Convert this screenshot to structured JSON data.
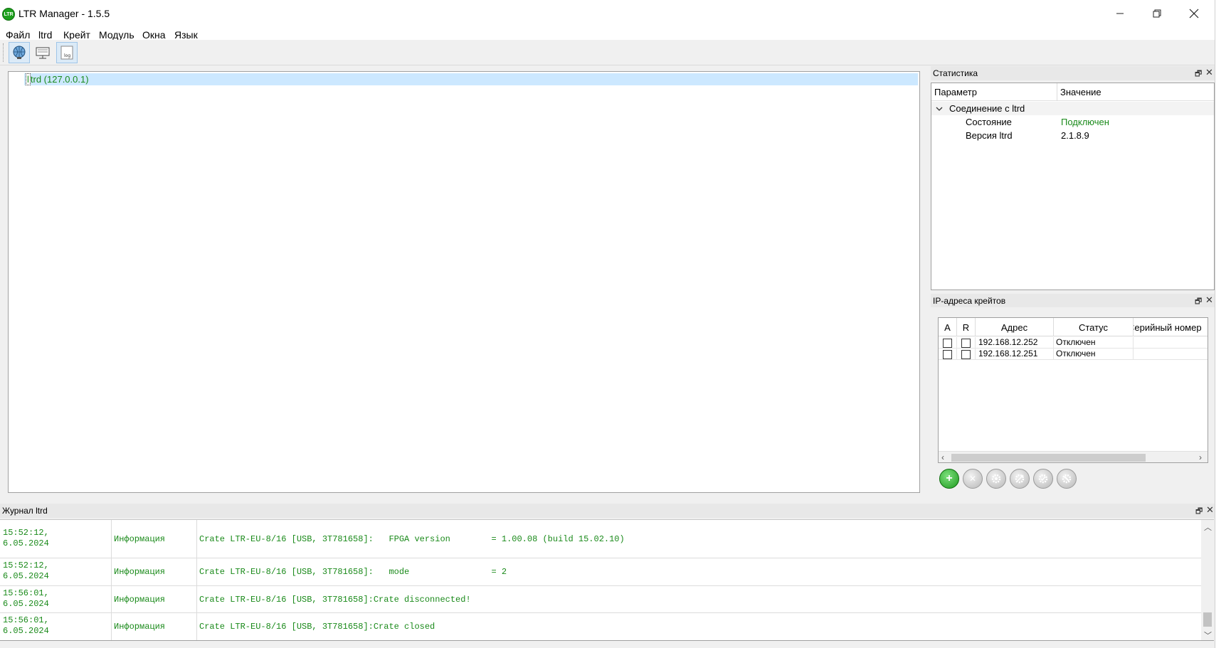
{
  "window": {
    "title": "LTR Manager - 1.5.5",
    "logo_text": "LTR",
    "minimize": "─",
    "maximize": "❐",
    "close": "✕"
  },
  "menu": [
    {
      "label": "Файл"
    },
    {
      "label": "ltrd"
    },
    {
      "label": "Крейт"
    },
    {
      "label": "Модуль"
    },
    {
      "label": "Окна"
    },
    {
      "label": "Язык"
    }
  ],
  "toolbar": {
    "log_label": "log"
  },
  "tree": {
    "item": "ltrd (127.0.0.1)",
    "item_first_char": "l",
    "item_rest": "trd (127.0.0.1)"
  },
  "stats": {
    "title": "Статистика",
    "col_param": "Параметр",
    "col_value": "Значение",
    "group": "Соединение с ltrd",
    "rows": [
      {
        "param": "Состояние",
        "value": "Подключен",
        "highlight": true
      },
      {
        "param": "Версия ltrd",
        "value": "2.1.8.9",
        "highlight": false
      }
    ]
  },
  "ip": {
    "title": "IP-адреса крейтов",
    "col_a": "A",
    "col_r": "R",
    "col_addr": "Адрес",
    "col_status": "Статус",
    "col_serial": "Серийный номер",
    "rows": [
      {
        "addr": "192.168.12.252",
        "status": "Отключен",
        "serial": ""
      },
      {
        "addr": "192.168.12.251",
        "status": "Отключен",
        "serial": ""
      }
    ],
    "add_icon": "+",
    "remove_icon": "✕"
  },
  "log": {
    "title": "Журнал ltrd",
    "rows": [
      {
        "time": "15:52:12,\n6.05.2024",
        "level": "Информация",
        "message": "Crate LTR-EU-8/16 [USB, 3T781658]:   FPGA version        = 1.00.08 (build 15.02.10)"
      },
      {
        "time": "15:52:12,\n6.05.2024",
        "level": "Информация",
        "message": "Crate LTR-EU-8/16 [USB, 3T781658]:   mode                = 2"
      },
      {
        "time": "15:56:01,\n6.05.2024",
        "level": "Информация",
        "message": "Crate LTR-EU-8/16 [USB, 3T781658]:Crate disconnected!"
      },
      {
        "time": "15:56:01,\n6.05.2024",
        "level": "Информация",
        "message": "Crate LTR-EU-8/16 [USB, 3T781658]:Crate closed"
      }
    ]
  },
  "colors": {
    "accent_green": "#1a8a1a",
    "selection": "#cce8ff"
  }
}
